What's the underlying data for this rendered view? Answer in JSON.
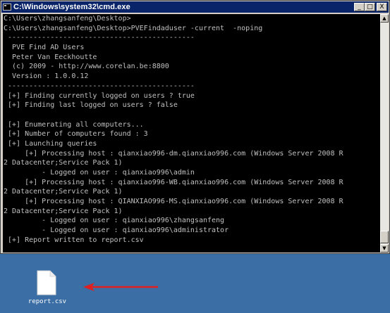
{
  "window": {
    "title": "C:\\Windows\\system32\\cmd.exe",
    "minimize_glyph": "_",
    "maximize_glyph": "□",
    "close_glyph": "X"
  },
  "console": {
    "lines": [
      "C:\\Users\\zhangsanfeng\\Desktop>",
      "C:\\Users\\zhangsanfeng\\Desktop>PVEFindaduser -current  -noping",
      " --------------------------------------------",
      "  PVE Find AD Users",
      "  Peter Van Eeckhoutte",
      "  (c) 2009 - http://www.corelan.be:8800",
      "  Version : 1.0.0.12",
      " --------------------------------------------",
      " [+] Finding currently logged on users ? true",
      " [+] Finding last logged on users ? false",
      "",
      " [+] Enumerating all computers...",
      " [+] Number of computers found : 3",
      " [+] Launching queries",
      "     [+] Processing host : qianxiao996-dm.qianxiao996.com (Windows Server 2008 R",
      "2 Datacenter;Service Pack 1)",
      "         - Logged on user : qianxiao996\\admin",
      "     [+] Processing host : qianxiao996-WB.qianxiao996.com (Windows Server 2008 R",
      "2 Datacenter;Service Pack 1)",
      "     [+] Processing host : QIANXIAO996-MS.qianxiao996.com (Windows Server 2008 R",
      "2 Datacenter;Service Pack 1)",
      "         - Logged on user : qianxiao996\\zhangsanfeng",
      "         - Logged on user : qianxiao996\\administrator",
      " [+] Report written to report.csv"
    ]
  },
  "desktop": {
    "file_label": "report.csv",
    "arrow_color": "#e02020",
    "file_icon": "blank-file-icon"
  }
}
